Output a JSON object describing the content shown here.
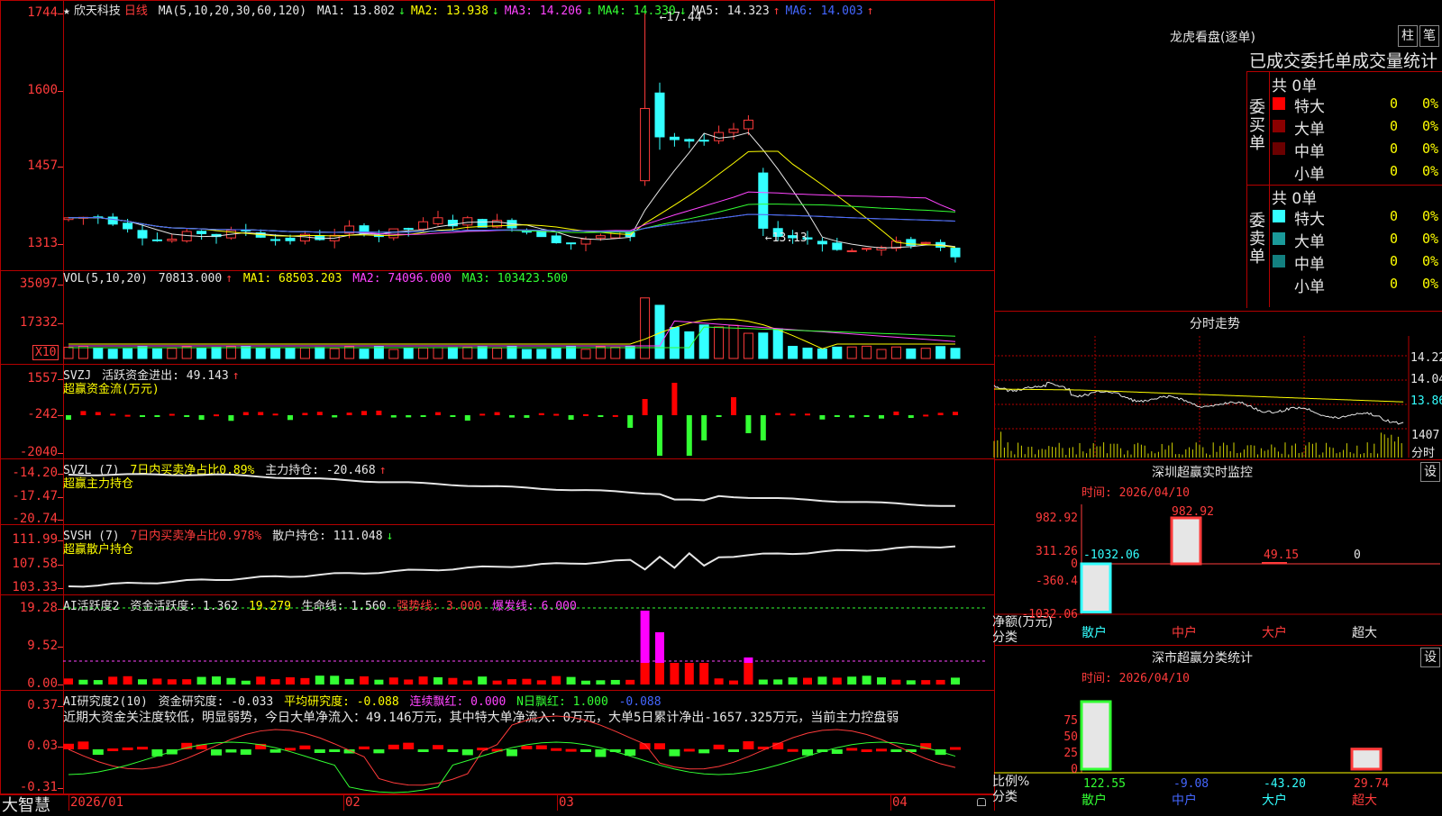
{
  "app": {
    "brand": "大智慧",
    "stock_star": "★",
    "stock_name": "欣天科技",
    "period": "日线"
  },
  "kline": {
    "ma_header": "MA(5,10,20,30,60,120)",
    "ma": [
      {
        "label": "MA1: 13.802",
        "arrow": "↓",
        "color": "#e6e6e6"
      },
      {
        "label": "MA2: 13.938",
        "arrow": "↓",
        "color": "#ffff00"
      },
      {
        "label": "MA3: 14.206",
        "arrow": "↓",
        "color": "#ff44ff"
      },
      {
        "label": "MA4: 14.330",
        "arrow": "↓",
        "color": "#33ff33"
      },
      {
        "label": "MA5: 14.323",
        "arrow": "↑",
        "color": "#e6e6e6"
      },
      {
        "label": "MA6: 14.003",
        "arrow": "↑",
        "color": "#4466ff"
      }
    ],
    "yticks": [
      "1744",
      "1600",
      "1457",
      "1313"
    ],
    "high_label": "17.44",
    "low_label": "13.13"
  },
  "vol": {
    "title": "VOL(5,10,20)",
    "value": "70813.000",
    "arrow": "↑",
    "ma1": "MA1: 68503.203",
    "ma2": "MA2: 74096.000",
    "ma3": "MA3: 103423.500",
    "yticks": [
      "35097",
      "17332"
    ],
    "unit": "X10"
  },
  "svzj": {
    "title": "SVZJ",
    "label": "活跃资金进出: 49.143",
    "arrow": "↑",
    "sub": "超赢资金流(万元)",
    "yticks": [
      "1557",
      "-242",
      "-2040"
    ]
  },
  "svzl": {
    "title": "SVZL (7)",
    "l1": "7日内买卖净占比0.89%",
    "l2": "主力持仓: -20.468",
    "arrow": "↑",
    "sub": "超赢主力持仓",
    "yticks": [
      "-14.20",
      "-17.47",
      "-20.74"
    ]
  },
  "svsh": {
    "title": "SVSH (7)",
    "l1": "7日内买卖净占比0.978%",
    "l2": "散户持仓: 111.048",
    "arrow": "↓",
    "sub": "超赢散户持仓",
    "yticks": [
      "111.99",
      "107.58",
      "103.33"
    ]
  },
  "ai1": {
    "title": "AI活跃度2",
    "l1": "资金活跃度: 1.362",
    "l2": "19.279",
    "l3": "生命线: 1.560",
    "l4": "强势线: 3.000",
    "l5": "爆发线: 6.000",
    "yticks": [
      "19.28",
      "9.52",
      "0.00"
    ]
  },
  "ai2": {
    "title": "AI研究度2(10)",
    "l1": "资金研究度: -0.033",
    "l2": "平均研究度: -0.088",
    "l3": "连续飘红: 0.000",
    "l4": "N日飘红: 1.000",
    "l5": "-0.088",
    "comment": "近期大资金关注度较低，明显弱势，今日大单净流入：49.146万元，其中特大单净流入：0万元，大单5日累计净出-1657.325万元，当前主力控盘弱",
    "yticks": [
      "0.37",
      "0.03",
      "-0.31"
    ]
  },
  "xaxis": [
    "2026/01",
    "02",
    "03",
    "04"
  ],
  "longhu": {
    "title": "龙虎看盘(逐单)",
    "btn1": "柱",
    "btn2": "笔",
    "subtitle": "已成交委托单成交量统计",
    "buy": {
      "label": "委买单",
      "total": "共 0单",
      "rows": [
        {
          "name": "特大",
          "v": "0",
          "p": "0%",
          "color": "#ff0000"
        },
        {
          "name": "大单",
          "v": "0",
          "p": "0%",
          "color": "#8b0000"
        },
        {
          "name": "中单",
          "v": "0",
          "p": "0%",
          "color": "#6b0000"
        },
        {
          "name": "小单",
          "v": "0",
          "p": "0%",
          "color": "#000000"
        }
      ]
    },
    "sell": {
      "label": "委卖单",
      "total": "共 0单",
      "rows": [
        {
          "name": "特大",
          "v": "0",
          "p": "0%",
          "color": "#33ffff"
        },
        {
          "name": "大单",
          "v": "0",
          "p": "0%",
          "color": "#1a9a9a"
        },
        {
          "name": "中单",
          "v": "0",
          "p": "0%",
          "color": "#138080"
        },
        {
          "name": "小单",
          "v": "0",
          "p": "0%",
          "color": "#000000"
        }
      ]
    }
  },
  "fenshi": {
    "title": "分时走势",
    "yticks": [
      "14.22",
      "14.04",
      "13.86"
    ],
    "vol_tick": "1407",
    "label": "分时"
  },
  "szmon": {
    "title": "深圳超赢实时监控",
    "btn": "设",
    "time": "时间: 2026/04/10",
    "yticks": [
      "982.92",
      "311.26",
      "0",
      "-360.4",
      "-1032.06"
    ],
    "ylabel": "净额(万元)",
    "xlabel": "分类",
    "cats": [
      "散户",
      "中户",
      "大户",
      "超大"
    ],
    "values_label": [
      "-1032.06",
      "982.92",
      "49.15",
      "0"
    ]
  },
  "szcls": {
    "title": "深市超赢分类统计",
    "btn": "设",
    "time": "时间: 2026/04/10",
    "yticks": [
      "75",
      "50",
      "25",
      "0"
    ],
    "ylabel": "比例%",
    "xlabel": "分类",
    "cats": [
      "散户",
      "中户",
      "大户",
      "超大"
    ],
    "values_label": [
      "122.55",
      "-9.08",
      "-43.20",
      "29.74"
    ]
  },
  "chart_data": [
    {
      "type": "candlestick",
      "title": "欣天科技 日线",
      "ylim": [
        13.13,
        17.44
      ],
      "high": 17.44,
      "low": 13.13,
      "ma": {
        "MA1": 13.802,
        "MA2": 13.938,
        "MA3": 14.206,
        "MA4": 14.33,
        "MA5": 14.323,
        "MA6": 14.003
      }
    },
    {
      "type": "bar",
      "title": "VOL(5,10,20)",
      "value": 70813.0,
      "ma": {
        "MA1": 68503.203,
        "MA2": 74096.0,
        "MA3": 103423.5
      }
    },
    {
      "type": "bar",
      "title": "超赢资金流(万元)",
      "value": 49.143
    },
    {
      "type": "line",
      "title": "超赢主力持仓",
      "value": -20.468,
      "ylim": [
        -20.74,
        -14.2
      ]
    },
    {
      "type": "line",
      "title": "超赢散户持仓",
      "value": 111.048,
      "ylim": [
        103.33,
        111.99
      ]
    },
    {
      "type": "bar",
      "title": "深圳超赢实时监控",
      "categories": [
        "散户",
        "中户",
        "大户",
        "超大"
      ],
      "values": [
        -1032.06,
        982.92,
        49.15,
        0
      ]
    },
    {
      "type": "bar",
      "title": "深市超赢分类统计",
      "categories": [
        "散户",
        "中户",
        "大户",
        "超大"
      ],
      "values": [
        122.55,
        -9.08,
        -43.2,
        29.74
      ]
    }
  ],
  "colors": {
    "up": "#ff3b3b",
    "down": "#33ffff",
    "border": "#b40000",
    "bg": "#000000"
  }
}
